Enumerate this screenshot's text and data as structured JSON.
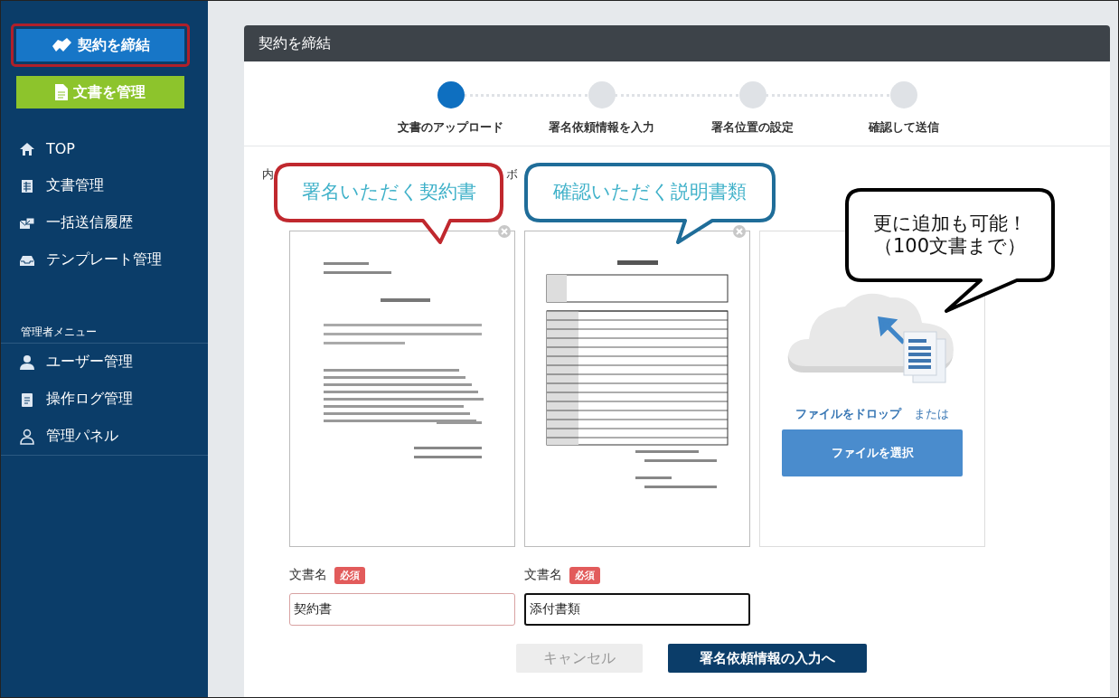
{
  "sidebar": {
    "action_buttons": [
      {
        "kind": "primary",
        "label": "契約を締結",
        "highlighted": true
      },
      {
        "kind": "secondary",
        "label": "文書を管理",
        "highlighted": false
      }
    ],
    "items": [
      {
        "label": "TOP"
      },
      {
        "label": "文書管理"
      },
      {
        "label": "一括送信履歴"
      },
      {
        "label": "テンプレート管理"
      }
    ],
    "admin_section": {
      "title": "管理者メニュー",
      "items": [
        {
          "label": "ユーザー管理"
        },
        {
          "label": "操作ログ管理"
        },
        {
          "label": "管理パネル"
        }
      ]
    }
  },
  "panel": {
    "title": "契約を締結",
    "steps": [
      {
        "label": "文書のアップロード",
        "active": true
      },
      {
        "label": "署名依頼情報を入力",
        "active": false
      },
      {
        "label": "署名位置の設定",
        "active": false
      },
      {
        "label": "確認して送信",
        "active": false
      }
    ],
    "instruction_fragments": [
      "内",
      "ボ"
    ],
    "documents": [
      {
        "name_label": "文書名",
        "required_badge": "必須",
        "value": "契約書",
        "focused": false
      },
      {
        "name_label": "文書名",
        "required_badge": "必須",
        "value": "添付書類",
        "focused": true
      }
    ],
    "dropzone": {
      "drop_text": "ファイルをドロップ",
      "or_text": "または",
      "select_button": "ファイルを選択"
    },
    "buttons": {
      "cancel": {
        "label": "キャンセル",
        "disabled": true
      },
      "next": {
        "label": "署名依頼情報の入力へ"
      }
    }
  },
  "callouts": [
    {
      "lines": [
        "署名いただく契約書"
      ]
    },
    {
      "lines": [
        "確認いただく説明書類"
      ]
    },
    {
      "lines": [
        "更に追加も可能！",
        "（100文書まで）"
      ]
    }
  ]
}
